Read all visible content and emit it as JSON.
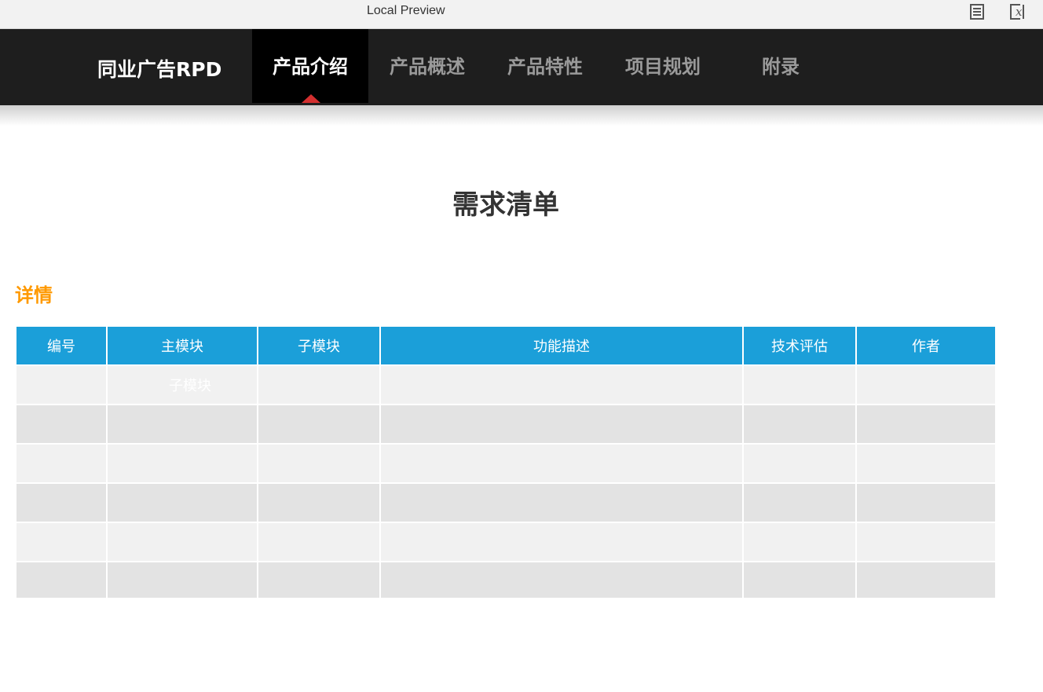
{
  "window": {
    "title": "Local Preview",
    "icons": [
      "document-icon",
      "clear-variables-icon"
    ]
  },
  "nav": {
    "brand": "同业广告RPD",
    "tabs": [
      {
        "label": "产品介绍",
        "active": true
      },
      {
        "label": "产品概述",
        "active": false
      },
      {
        "label": "产品特性",
        "active": false
      },
      {
        "label": "项目规划",
        "active": false
      },
      {
        "label": "附录",
        "active": false
      }
    ]
  },
  "main": {
    "page_title": "需求清单",
    "section_title": "详情",
    "table": {
      "headers": [
        "编号",
        "主模块",
        "子模块",
        "功能描述",
        "技术评估",
        "作者"
      ],
      "rows": [
        [
          "",
          "子模块",
          "",
          "",
          "",
          ""
        ],
        [
          "",
          "",
          "",
          "",
          "",
          ""
        ],
        [
          "",
          "",
          "",
          "",
          "",
          ""
        ],
        [
          "",
          "",
          "",
          "",
          "",
          ""
        ],
        [
          "",
          "",
          "",
          "",
          "",
          ""
        ],
        [
          "",
          "",
          "",
          "",
          "",
          ""
        ]
      ]
    }
  },
  "colors": {
    "nav_background": "#1e1e1e",
    "active_tab_background": "#000000",
    "active_indicator": "#d32f2f",
    "section_title": "#ff9900",
    "table_header": "#1b9fd9",
    "row_light": "#f1f1f1",
    "row_dark": "#e3e3e3"
  }
}
